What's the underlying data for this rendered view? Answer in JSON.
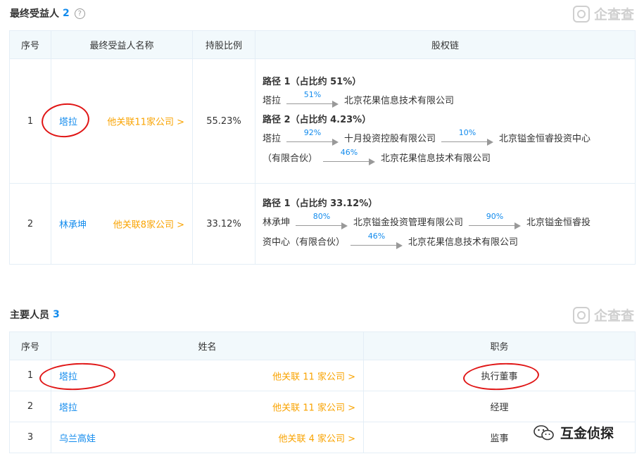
{
  "beneficiaries": {
    "title": "最终受益人",
    "count": "2",
    "help": "?",
    "headers": [
      "序号",
      "最终受益人名称",
      "持股比例",
      "股权链"
    ],
    "rows": [
      {
        "index": "1",
        "name": "塔拉",
        "related": "他关联11家公司 >",
        "ratio": "55.23%",
        "paths": [
          {
            "title": "路径 1（占比约 51%）",
            "lines": [
              [
                {
                  "t": "塔拉"
                },
                {
                  "p": "51%"
                },
                {
                  "t": "北京花果信息技术有限公司"
                }
              ]
            ]
          },
          {
            "title": "路径 2（占比约 4.23%）",
            "lines": [
              [
                {
                  "t": "塔拉"
                },
                {
                  "p": "92%"
                },
                {
                  "t": "十月投资控股有限公司"
                },
                {
                  "p": "10%"
                },
                {
                  "t": "北京镒金恒睿投资中心"
                }
              ],
              [
                {
                  "t": "（有限合伙）"
                },
                {
                  "p": "46%"
                },
                {
                  "t": "北京花果信息技术有限公司"
                }
              ]
            ]
          }
        ]
      },
      {
        "index": "2",
        "name": "林承坤",
        "related": "他关联8家公司 >",
        "ratio": "33.12%",
        "paths": [
          {
            "title": "路径 1（占比约 33.12%）",
            "lines": [
              [
                {
                  "t": "林承坤"
                },
                {
                  "p": "80%"
                },
                {
                  "t": "北京镒金投资管理有限公司"
                },
                {
                  "p": "90%"
                },
                {
                  "t": "北京镒金恒睿投"
                }
              ],
              [
                {
                  "t": "资中心（有限合伙）"
                },
                {
                  "p": "46%"
                },
                {
                  "t": "北京花果信息技术有限公司"
                }
              ]
            ]
          }
        ]
      }
    ]
  },
  "personnel": {
    "title": "主要人员",
    "count": "3",
    "headers": [
      "序号",
      "姓名",
      "职务"
    ],
    "rows": [
      {
        "index": "1",
        "name": "塔拉",
        "related": "他关联 11 家公司 >",
        "role": "执行董事"
      },
      {
        "index": "2",
        "name": "塔拉",
        "related": "他关联 11 家公司 >",
        "role": "经理"
      },
      {
        "index": "3",
        "name": "乌兰高娃",
        "related": "他关联 4 家公司 >",
        "role": "监事"
      }
    ]
  },
  "watermark": {
    "text": "企查查",
    "icon": "qichacha-logo-icon"
  },
  "footer": {
    "brand": "互金侦探",
    "icon": "wechat-icon"
  },
  "colors": {
    "link": "#128bed",
    "related": "#f9a300",
    "header_bg": "#f2f9fc",
    "border": "#e4eef6",
    "circle": "#e01515"
  }
}
